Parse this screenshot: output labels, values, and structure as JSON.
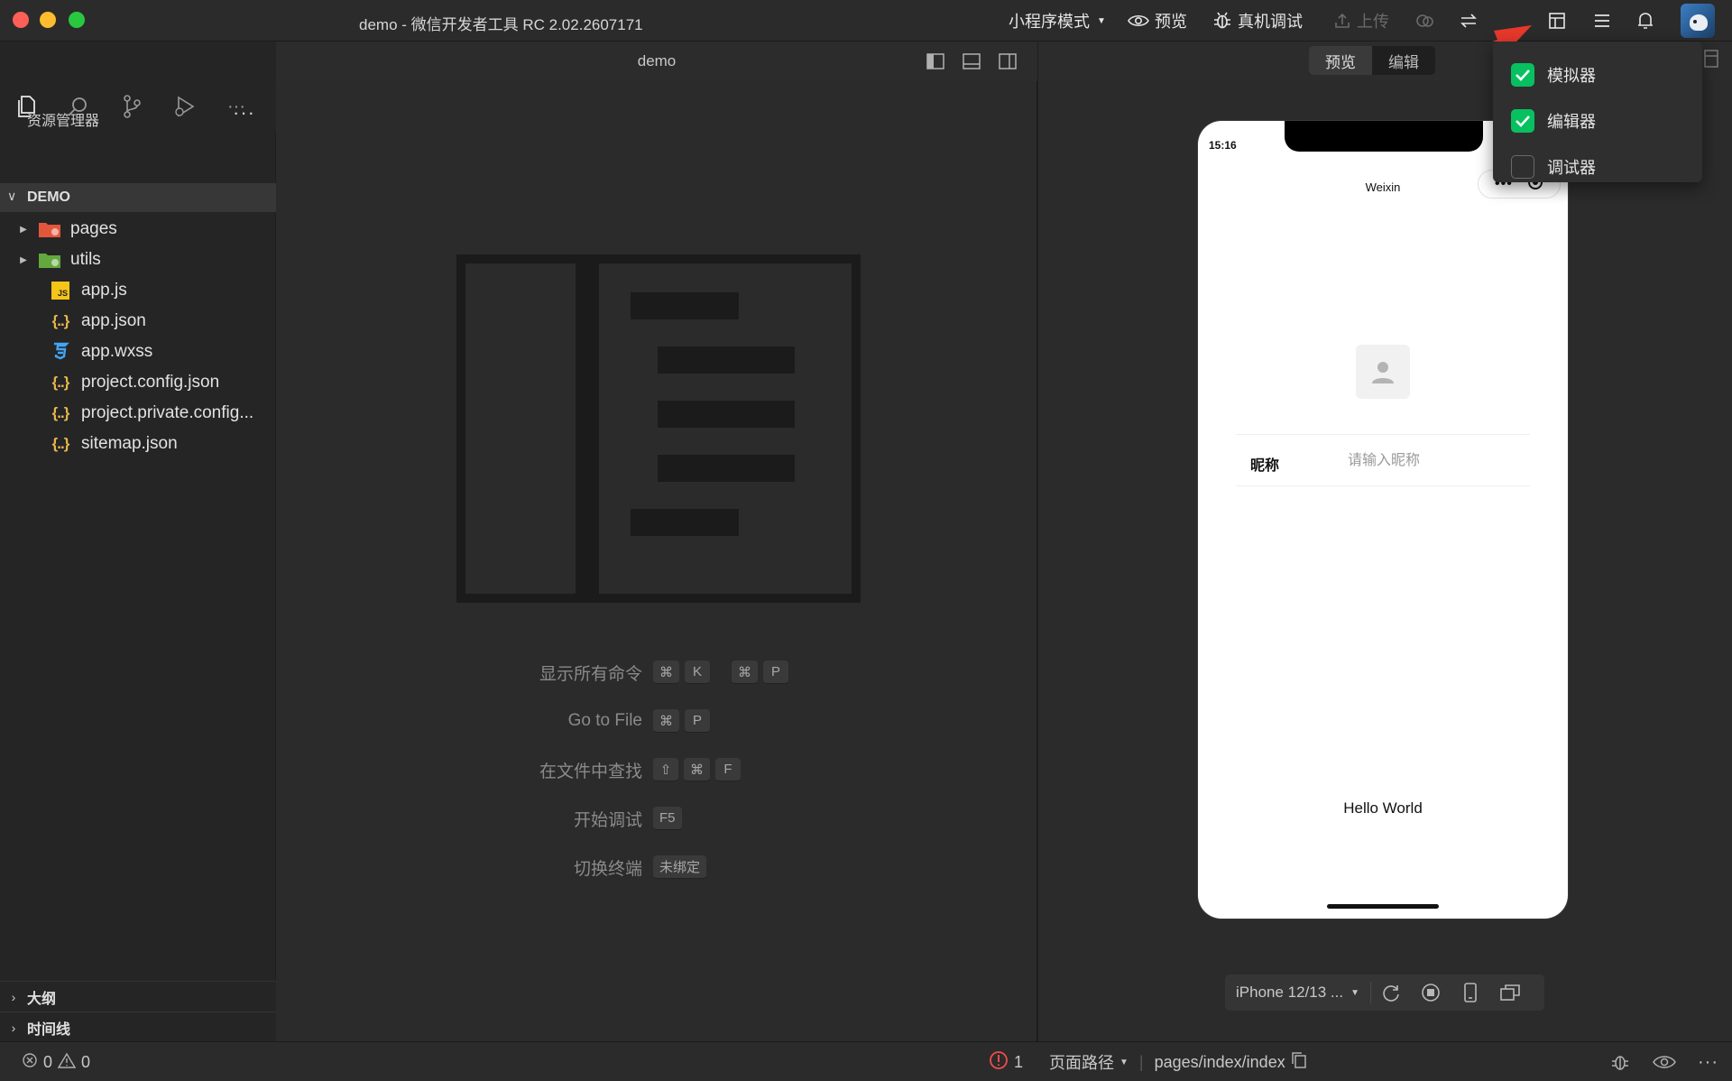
{
  "window": {
    "title": "demo - 微信开发者工具 RC 2.02.2607171"
  },
  "toolbar": {
    "mode_label": "小程序模式",
    "preview_label": "预览",
    "remote_debug_label": "真机调试",
    "upload_label": "上传",
    "icons": [
      "cloud-icon",
      "switch-icon",
      "layout-icon",
      "menu-icon",
      "bell-icon",
      "avatar"
    ]
  },
  "sidebar": {
    "activity_icons": [
      "files-icon",
      "search-icon",
      "source-control-icon",
      "debug-icon",
      "more-icon"
    ],
    "explorer_title": "资源管理器",
    "explorer_more": "···",
    "section": "DEMO",
    "tree": [
      {
        "name": "pages",
        "type": "folder",
        "icon": "pages-folder-icon",
        "color": "#e2573c"
      },
      {
        "name": "utils",
        "type": "folder",
        "icon": "utils-folder-icon",
        "color": "#63a83e"
      },
      {
        "name": "app.js",
        "type": "file",
        "icon": "js-file-icon",
        "color": "#f5c518"
      },
      {
        "name": "app.json",
        "type": "file",
        "icon": "json-file-icon",
        "color": "#e8b64b"
      },
      {
        "name": "app.wxss",
        "type": "file",
        "icon": "css-file-icon",
        "color": "#42a5f5"
      },
      {
        "name": "project.config.json",
        "type": "file",
        "icon": "json-file-icon",
        "color": "#e8b64b"
      },
      {
        "name": "project.private.config...",
        "type": "file",
        "icon": "json-file-icon",
        "color": "#e8b64b"
      },
      {
        "name": "sitemap.json",
        "type": "file",
        "icon": "json-file-icon",
        "color": "#e8b64b"
      }
    ],
    "outline_label": "大纲",
    "timeline_label": "时间线"
  },
  "editor": {
    "title": "demo",
    "shortcuts": [
      {
        "label": "显示所有命令",
        "keys": [
          [
            "⌘",
            "K"
          ],
          [
            "⌘",
            "P"
          ]
        ]
      },
      {
        "label": "Go to File",
        "keys": [
          [
            "⌘",
            "P"
          ]
        ]
      },
      {
        "label": "在文件中查找",
        "keys": [
          [
            "⇧",
            "⌘",
            "F"
          ]
        ]
      },
      {
        "label": "开始调试",
        "keys": [
          [
            "F5"
          ]
        ]
      },
      {
        "label": "切换终端",
        "keys": [
          [
            "未绑定"
          ]
        ]
      }
    ]
  },
  "simulator": {
    "seg_preview": "预览",
    "seg_edit": "编辑",
    "status_time": "15:16",
    "nav_title": "Weixin",
    "nickname_label": "昵称",
    "nickname_placeholder": "请输入昵称",
    "hello_text": "Hello World",
    "device": "iPhone 12/13 ...",
    "tools": [
      "refresh-icon",
      "stop-icon",
      "phone-icon",
      "multi-window-icon"
    ]
  },
  "dropdown": {
    "items": [
      {
        "label": "模拟器",
        "checked": true
      },
      {
        "label": "编辑器",
        "checked": true
      },
      {
        "label": "调试器",
        "checked": false
      }
    ]
  },
  "statusbar": {
    "errors": "0",
    "warnings": "0",
    "alerts": "1",
    "path_label": "页面路径",
    "path_value": "pages/index/index"
  },
  "colors": {
    "accent_green": "#07c160",
    "arrow_red": "#e8382c",
    "error_red": "#f14c4c"
  }
}
